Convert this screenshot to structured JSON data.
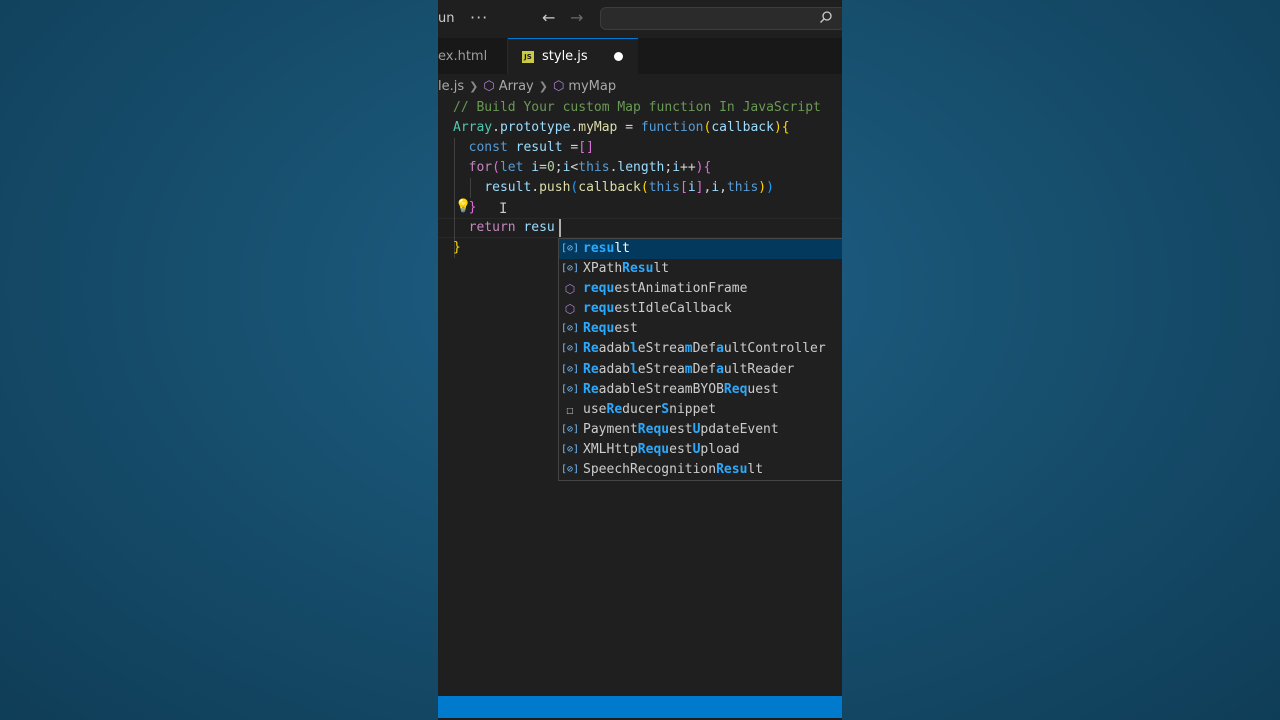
{
  "titlebar": {
    "menu_run": "un",
    "more": "···",
    "back": "←",
    "forward": "→",
    "search_icon": "⚲",
    "search_placeholder": ""
  },
  "tabs": [
    {
      "label": "ex.html",
      "active": false
    },
    {
      "label": "style.js",
      "active": true,
      "icon": "JS",
      "dirty": true
    }
  ],
  "breadcrumb": {
    "file": "le.js",
    "items": [
      "Array",
      "myMap"
    ]
  },
  "editor": {
    "lines": [
      "// Build Your custom Map function In JavaScript",
      "Array.prototype.myMap = function(callback){",
      "  const result =[]",
      "  for(let i=0;i<this.length;i++){",
      "    result.push(callback(this[i],i,this))",
      "  }",
      "  return resu",
      "}"
    ],
    "typed_prefix": "resu"
  },
  "suggestions": [
    {
      "kind": "variable",
      "label": "result",
      "selected": true,
      "match": [
        0,
        1,
        2,
        3
      ]
    },
    {
      "kind": "variable",
      "label": "XPathResult",
      "match": [
        5,
        6,
        7,
        8
      ]
    },
    {
      "kind": "method",
      "label": "requestAnimationFrame",
      "match": [
        0,
        1,
        2,
        3
      ]
    },
    {
      "kind": "method",
      "label": "requestIdleCallback",
      "match": [
        0,
        1,
        2,
        3
      ]
    },
    {
      "kind": "variable",
      "label": "Request",
      "match": [
        0,
        1,
        2,
        3
      ]
    },
    {
      "kind": "variable",
      "label": "ReadableStreamDefaultController",
      "match": [
        0,
        1,
        6,
        13,
        17
      ]
    },
    {
      "kind": "variable",
      "label": "ReadableStreamDefaultReader",
      "match": [
        0,
        1,
        6,
        13,
        17
      ]
    },
    {
      "kind": "variable",
      "label": "ReadableStreamBYOBRequest",
      "match": [
        0,
        1,
        18,
        19,
        20
      ]
    },
    {
      "kind": "snippet",
      "label": "useReducerSnippet",
      "match": [
        3,
        4,
        10
      ]
    },
    {
      "kind": "variable",
      "label": "PaymentRequestUpdateEvent",
      "match": [
        7,
        8,
        9,
        10,
        14
      ]
    },
    {
      "kind": "variable",
      "label": "XMLHttpRequestUpload",
      "match": [
        7,
        8,
        9,
        10,
        14
      ]
    },
    {
      "kind": "variable",
      "label": "SpeechRecognitionResult",
      "match": [
        17,
        18,
        19,
        20
      ]
    }
  ],
  "colors": {
    "accent": "#0078d4",
    "statusbar": "#007acc",
    "editor_bg": "#1f1f1f",
    "selected_suggestion": "#04395e",
    "match_highlight": "#2aaaff"
  }
}
